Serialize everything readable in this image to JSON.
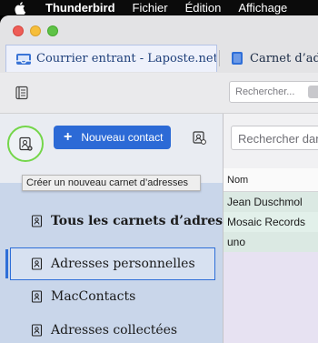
{
  "menubar": {
    "app": "Thunderbird",
    "items": [
      "Fichier",
      "Édition",
      "Affichage"
    ]
  },
  "tabs": [
    {
      "label": "Courrier entrant - Laposte.net",
      "icon": "mail-inbox-icon"
    },
    {
      "label": "Carnet d’adresses",
      "icon": "address-book-icon"
    }
  ],
  "toolbar": {
    "search_placeholder": "Rechercher..."
  },
  "left_panel": {
    "new_contact_label": "Nouveau contact",
    "tooltip": "Créer un nouveau carnet d’adresses",
    "books": [
      {
        "label": "Tous les carnets d’adresses",
        "icon": "address-book-icon"
      },
      {
        "label": "Adresses personnelles",
        "icon": "address-book-icon"
      },
      {
        "label": "MacContacts",
        "icon": "address-book-icon"
      },
      {
        "label": "Adresses collectées",
        "icon": "address-book-icon"
      }
    ]
  },
  "right_panel": {
    "search_placeholder": "Rechercher dans",
    "column_header": "Nom",
    "rows": [
      "Jean Duschmol",
      "Mosaic Records",
      "uno"
    ]
  },
  "colors": {
    "accent": "#2c6ad6",
    "highlight_ring": "#74d64a",
    "sidebar_bg": "#c9d6ea"
  }
}
